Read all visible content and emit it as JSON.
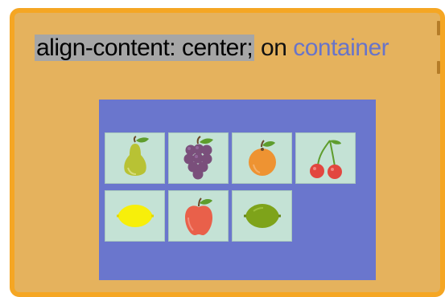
{
  "heading": {
    "code": "align-content: center;",
    "middle": " on ",
    "target": "container"
  },
  "colors": {
    "frame": "#e5b25d",
    "frame_border": "#f5a623",
    "container": "#6a76cd",
    "tile": "#c4e2d5",
    "code_highlight": "#a6a6a6",
    "target_text": "#6874c9"
  },
  "items": [
    {
      "name": "pear",
      "icon": "pear-icon"
    },
    {
      "name": "grapes",
      "icon": "grapes-icon"
    },
    {
      "name": "orange",
      "icon": "orange-icon"
    },
    {
      "name": "cherries",
      "icon": "cherries-icon"
    },
    {
      "name": "lemon",
      "icon": "lemon-icon"
    },
    {
      "name": "apple",
      "icon": "apple-icon"
    },
    {
      "name": "lime",
      "icon": "lime-icon"
    }
  ]
}
